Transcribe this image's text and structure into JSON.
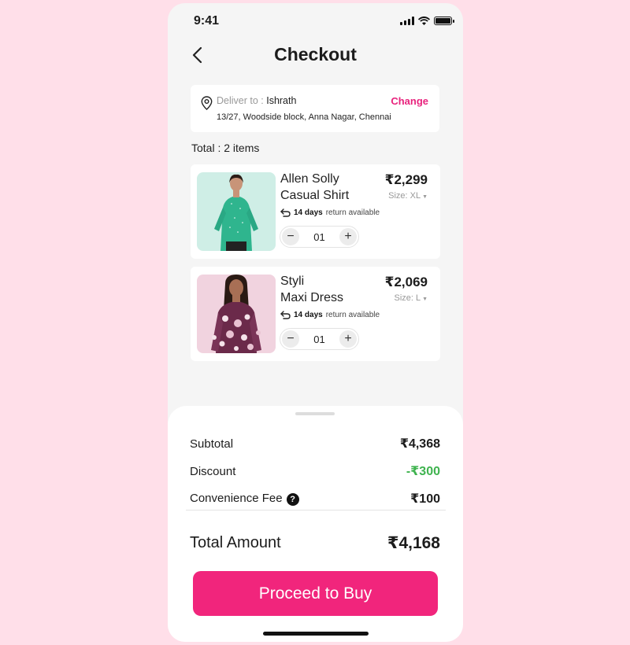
{
  "status_bar": {
    "time": "9:41"
  },
  "header": {
    "title": "Checkout"
  },
  "delivery": {
    "label": "Deliver to : ",
    "name": "Ishrath",
    "address": "13/27, Woodside block, Anna Nagar, Chennai",
    "change_label": "Change"
  },
  "cart": {
    "total_label": "Total : 2 items",
    "items": [
      {
        "brand": "Allen Solly",
        "name": "Casual Shirt",
        "price": "₹2,299",
        "size": "Size: XL",
        "return_days": "14 days",
        "return_text": "return available",
        "quantity": "01"
      },
      {
        "brand": "Styli",
        "name": "Maxi Dress",
        "price": "₹2,069",
        "size": "Size: L",
        "return_days": "14 days",
        "return_text": "return available",
        "quantity": "01"
      }
    ]
  },
  "summary": {
    "subtotal_label": "Subtotal",
    "subtotal_value": "₹4,368",
    "discount_label": "Discount",
    "discount_value": "-₹300",
    "fee_label": "Convenience Fee",
    "fee_value": "₹100",
    "total_label": "Total Amount",
    "total_value": "₹4,168"
  },
  "cta": {
    "label": "Proceed to Buy"
  },
  "colors": {
    "accent": "#f1257c",
    "discount": "#3fb34f",
    "background": "#ffdfe9"
  }
}
